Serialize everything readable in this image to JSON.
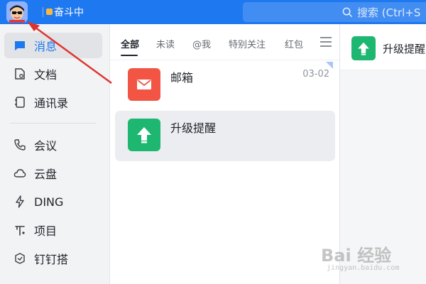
{
  "topbar": {
    "status_text": "奋斗中",
    "search_placeholder": "搜索 (Ctrl+S",
    "accent": "#1e78f0"
  },
  "sidebar": {
    "items": [
      {
        "label": "消息",
        "icon": "message-icon",
        "active": true
      },
      {
        "label": "文档",
        "icon": "document-icon"
      },
      {
        "label": "通讯录",
        "icon": "contacts-icon"
      },
      {
        "label": "会议",
        "icon": "phone-icon"
      },
      {
        "label": "云盘",
        "icon": "cloud-icon"
      },
      {
        "label": "DING",
        "icon": "lightning-icon"
      },
      {
        "label": "项目",
        "icon": "project-icon"
      },
      {
        "label": "钉钉搭",
        "icon": "builder-icon"
      }
    ]
  },
  "tabs": [
    {
      "label": "全部",
      "active": true
    },
    {
      "label": "未读"
    },
    {
      "label": "@我"
    },
    {
      "label": "特别关注"
    },
    {
      "label": "红包"
    }
  ],
  "conversations": [
    {
      "title": "邮箱",
      "time": "03-02",
      "icon": "mail-icon",
      "color": "#f25543"
    },
    {
      "title": "升级提醒",
      "time": "",
      "icon": "upgrade-arrow-icon",
      "color": "#1db771",
      "selected": true
    }
  ],
  "chat_panel": {
    "title": "升级提醒",
    "icon": "upgrade-arrow-icon"
  },
  "watermark": {
    "main": "Bai 经验",
    "sub": "jingyan.baidu.com"
  }
}
